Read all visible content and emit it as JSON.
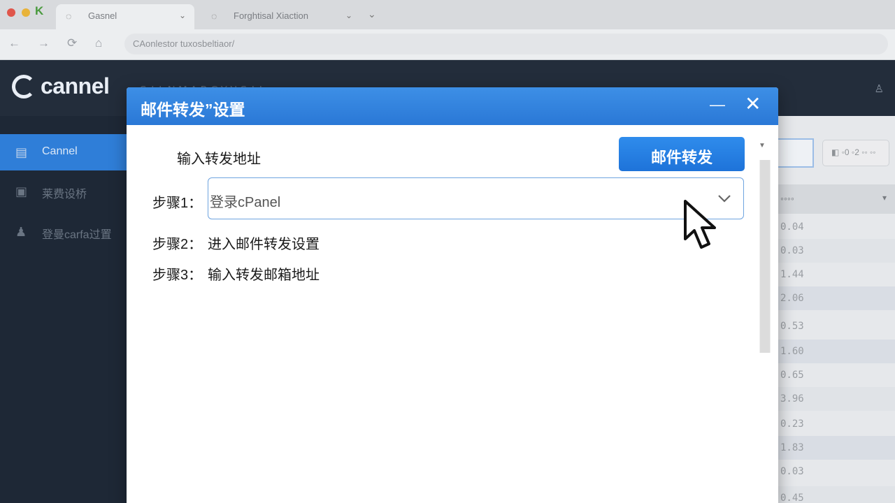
{
  "browser": {
    "tabs": [
      {
        "title": "Gasnel",
        "icon": "globe-icon",
        "active": true
      },
      {
        "title": "Forghtisal Xiaction",
        "icon": "globe-icon",
        "active": false
      }
    ],
    "window_glyph": "K",
    "address": "CAonlestor tuxosbeltiaor/"
  },
  "app": {
    "logo": "cannel",
    "header_text": "ꓢ ꓕ ꓡ ꓠ ꓟ ꓥ ꓣ  ꓚ ꓬ ꓤ ꓢ ꓕ ꓡ",
    "sidebar": {
      "items": [
        {
          "label": "Cannel",
          "icon": "list-icon",
          "active": true
        },
        {
          "label": "莱费设桥",
          "icon": "calendar-icon",
          "active": false
        },
        {
          "label": "登曼carfa过置",
          "icon": "user-icon",
          "active": false
        }
      ]
    },
    "right_panel": {
      "button_label": "◧ ◦0 ◦2 ◦◦ ◦◦",
      "column_header": "◦◦◦◦",
      "values": [
        "0.04",
        "0.03",
        "1.44",
        "2.06",
        "0.53",
        "1.60",
        "0.65",
        "3.96",
        "0.23",
        "1.83",
        "0.03",
        "0.45"
      ]
    }
  },
  "dialog": {
    "title": "邮件转发”设置",
    "forward_label": "输入转发地址",
    "forward_button": "邮件转发",
    "step1": {
      "label": "步骤1：",
      "value": "登录cPanel"
    },
    "step2": {
      "label": "步骤2：",
      "text": "进入邮件转发设置"
    },
    "step3": {
      "label": "步骤3：",
      "text": "输入转发邮箱地址"
    }
  },
  "colors": {
    "accent": "#2f7ed8",
    "titlebar": "#3d8fe6",
    "sidebar_bg": "#1e2836"
  }
}
